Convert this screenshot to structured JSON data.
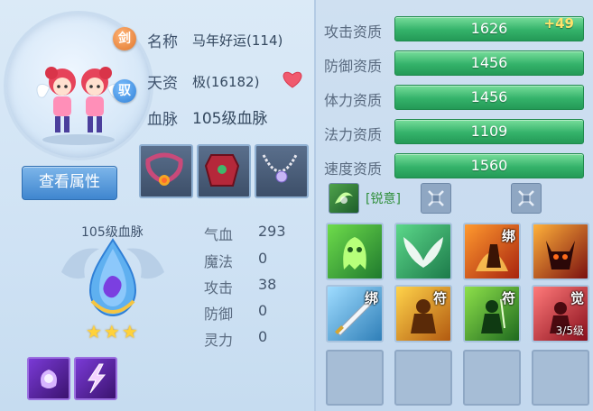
{
  "pet": {
    "name_label": "名称",
    "name_value": "马年好运(114)",
    "talent_label": "天资",
    "talent_value": "极(16182)",
    "bloodline_label": "血脉",
    "bloodline_value": "105级血脉",
    "sword_icon_text": "剑",
    "tame_icon_text": "驭"
  },
  "buttons": {
    "view_attributes": "查看属性"
  },
  "bloodline_panel": {
    "title": "105级血脉",
    "stars": "★★★"
  },
  "attributes": [
    {
      "label": "气血",
      "value": "293"
    },
    {
      "label": "魔法",
      "value": "0"
    },
    {
      "label": "攻击",
      "value": "38"
    },
    {
      "label": "防御",
      "value": "0"
    },
    {
      "label": "灵力",
      "value": "0"
    }
  ],
  "aptitudes": [
    {
      "label": "攻击资质",
      "value": "1626",
      "bonus": "+49"
    },
    {
      "label": "防御资质",
      "value": "1456",
      "bonus": ""
    },
    {
      "label": "体力资质",
      "value": "1456",
      "bonus": ""
    },
    {
      "label": "法力资质",
      "value": "1109",
      "bonus": ""
    },
    {
      "label": "速度资质",
      "value": "1560",
      "bonus": ""
    }
  ],
  "status": {
    "sharp_label": "[锐意]"
  },
  "skills": [
    {
      "icon": "green-ghost-icon",
      "tag": "",
      "sub": ""
    },
    {
      "icon": "white-wing-icon",
      "tag": "",
      "sub": ""
    },
    {
      "icon": "fire-bind-icon",
      "tag": "绑",
      "sub": ""
    },
    {
      "icon": "demon-head-icon",
      "tag": "",
      "sub": ""
    },
    {
      "icon": "sword-bind-icon",
      "tag": "绑",
      "sub": ""
    },
    {
      "icon": "gold-warrior-icon",
      "tag": "符",
      "sub": ""
    },
    {
      "icon": "green-warrior-icon",
      "tag": "符",
      "sub": ""
    },
    {
      "icon": "red-awaken-icon",
      "tag": "觉",
      "sub": "3/5级"
    }
  ],
  "colors": {
    "aptitude_bar": "#34b26a",
    "bonus_text": "#ffe26a",
    "sharp_text": "#2f8f3b",
    "heart": "#f05a6e"
  }
}
